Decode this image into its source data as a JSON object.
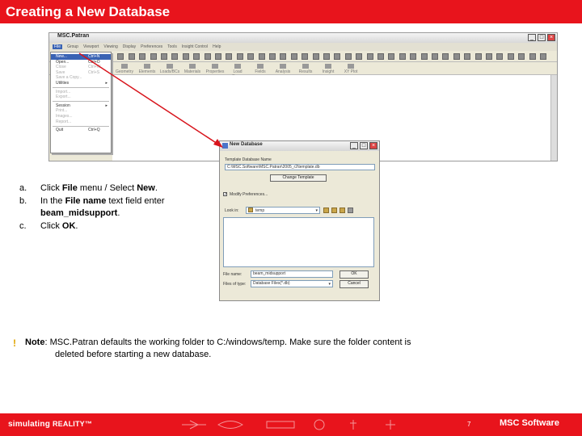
{
  "header": {
    "title": "Creating a New Database"
  },
  "patran": {
    "window_title": "MSC.Patran",
    "menus": [
      "File",
      "Group",
      "Viewport",
      "Viewing",
      "Display",
      "Preferences",
      "Tools",
      "Insight Control",
      "Help"
    ],
    "apps": [
      "Geometry",
      "Elements",
      "Loads/BCs",
      "Materials",
      "Properties",
      "Load Cases",
      "Fields",
      "Analysis",
      "Results",
      "Insight",
      "XY Plot"
    ],
    "file_menu": {
      "items": [
        {
          "label": "New...",
          "shortcut": "Ctrl+N"
        },
        {
          "label": "Open...",
          "shortcut": "Ctrl+O"
        },
        {
          "label": "Close",
          "shortcut": "Ctrl+W"
        },
        {
          "label": "Save",
          "shortcut": "Ctrl+S"
        },
        {
          "label": "Save a Copy...",
          "shortcut": ""
        },
        {
          "label": "Utilities",
          "shortcut": ""
        },
        {
          "label": "Import...",
          "shortcut": ""
        },
        {
          "label": "Export...",
          "shortcut": ""
        },
        {
          "label": "Session",
          "shortcut": ""
        },
        {
          "label": "Print...",
          "shortcut": ""
        },
        {
          "label": "Images...",
          "shortcut": ""
        },
        {
          "label": "Report...",
          "shortcut": ""
        },
        {
          "label": "Quit",
          "shortcut": "Ctrl+Q"
        }
      ]
    }
  },
  "steps": [
    {
      "label": "a.",
      "text_before": "Click ",
      "bold1": "File",
      "text_mid": " menu / Select ",
      "bold2": "New",
      "text_after": "."
    },
    {
      "label": "b.",
      "text_before": "In the ",
      "bold1": "File name",
      "text_mid": " text field enter ",
      "bold2": "beam_midsupport",
      "text_after": "."
    },
    {
      "label": "c.",
      "text_before": "Click ",
      "bold1": "OK",
      "text_mid": "",
      "bold2": "",
      "text_after": "."
    }
  ],
  "new_database_dialog": {
    "title": "New Database",
    "template_label": "Template Database Name",
    "template_value": "C:\\MSC.Software\\MSC.Patran\\2005_r2\\template.db",
    "change_template_label": "Change Template",
    "modify_preferences_label": "Modify Preferences...",
    "look_in_label": "Look in:",
    "look_in_value": "temp",
    "file_name_label": "File name:",
    "file_name_value": "beam_midsupport",
    "file_type_label": "Files of type:",
    "file_type_value": "Database Files(*.db)",
    "ok_label": "OK",
    "cancel_label": "Cancel"
  },
  "note": {
    "label": "Note",
    "line1": ": MSC.Patran defaults the working folder to C:/windows/temp. Make sure the folder content is",
    "line2": "deleted before starting a new database."
  },
  "footer": {
    "brand": "simulating ",
    "brand_bold": "REALITY™",
    "page_number": "7",
    "logo": "MSC Software"
  },
  "colors": {
    "accent": "#e8141c",
    "menu_highlight": "#3a63b4",
    "arrow": "#d8141c"
  }
}
